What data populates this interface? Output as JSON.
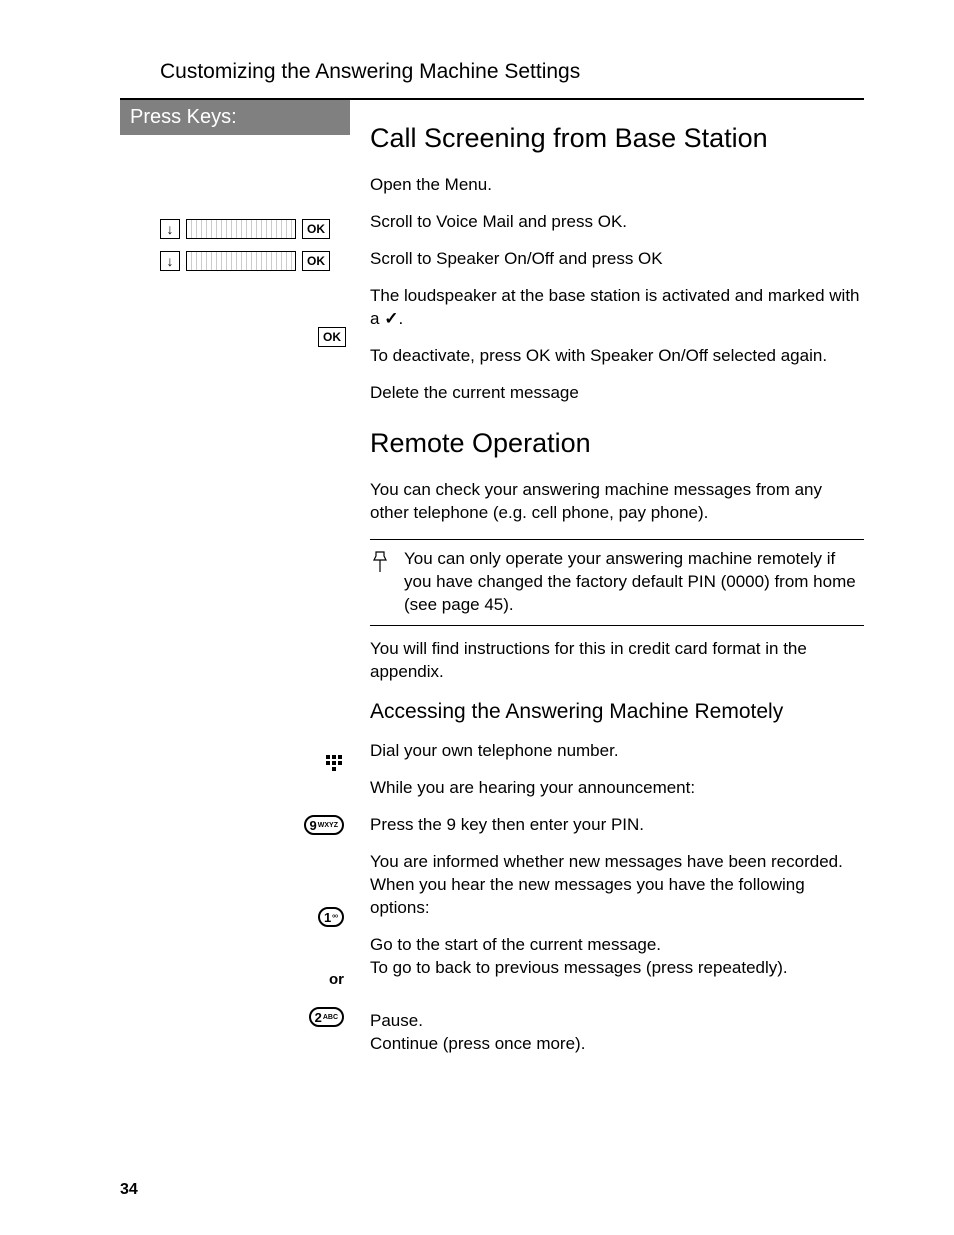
{
  "header": {
    "title": "Customizing the Answering Machine Settings"
  },
  "left": {
    "press_keys_label": "Press Keys:",
    "ok_label": "OK",
    "down_glyph": "↓",
    "or_label": "or",
    "key9": {
      "digit": "9",
      "letters": "WXYZ"
    },
    "key1": {
      "digit": "1",
      "letters": "ᵒᵒ"
    },
    "key2": {
      "digit": "2",
      "letters": "ABC"
    },
    "dial_glyph": "⠿"
  },
  "section1": {
    "title": "Call Screening from Base Station",
    "p1": "Open the Menu.",
    "p2": "Scroll to Voice Mail and press OK.",
    "p3": "Scroll to Speaker On/Off and press OK",
    "p4a": "The loudspeaker at the base station is activated and marked with a ",
    "p4_check": "✓",
    "p4b": ".",
    "p5": "To deactivate, press OK with Speaker On/Off selected again.",
    "p6": "Delete the current message"
  },
  "section2": {
    "title": "Remote Operation",
    "p1": "You can check your answering machine messages from any other telephone (e.g. cell phone, pay phone).",
    "note": "You can only operate your answering machine remotely if you have changed the factory default PIN (0000) from home (see page 45).",
    "p2": "You will find instructions for this in credit card format in the appendix."
  },
  "section3": {
    "title": "Accessing the Answering Machine Remotely",
    "p1": "Dial your own telephone number.",
    "p2": "While you are hearing your announcement:",
    "p3": "Press the 9 key then enter your PIN.",
    "p4": "You are informed whether new messages have been recorded.  When you hear the new messages you have the following options:",
    "p5a": "Go to the start of the current message.",
    "p5b": "To go to back to previous messages (press repeatedly).",
    "p6a": "Pause.",
    "p6b": "Continue (press once more)."
  },
  "page_number": "34"
}
